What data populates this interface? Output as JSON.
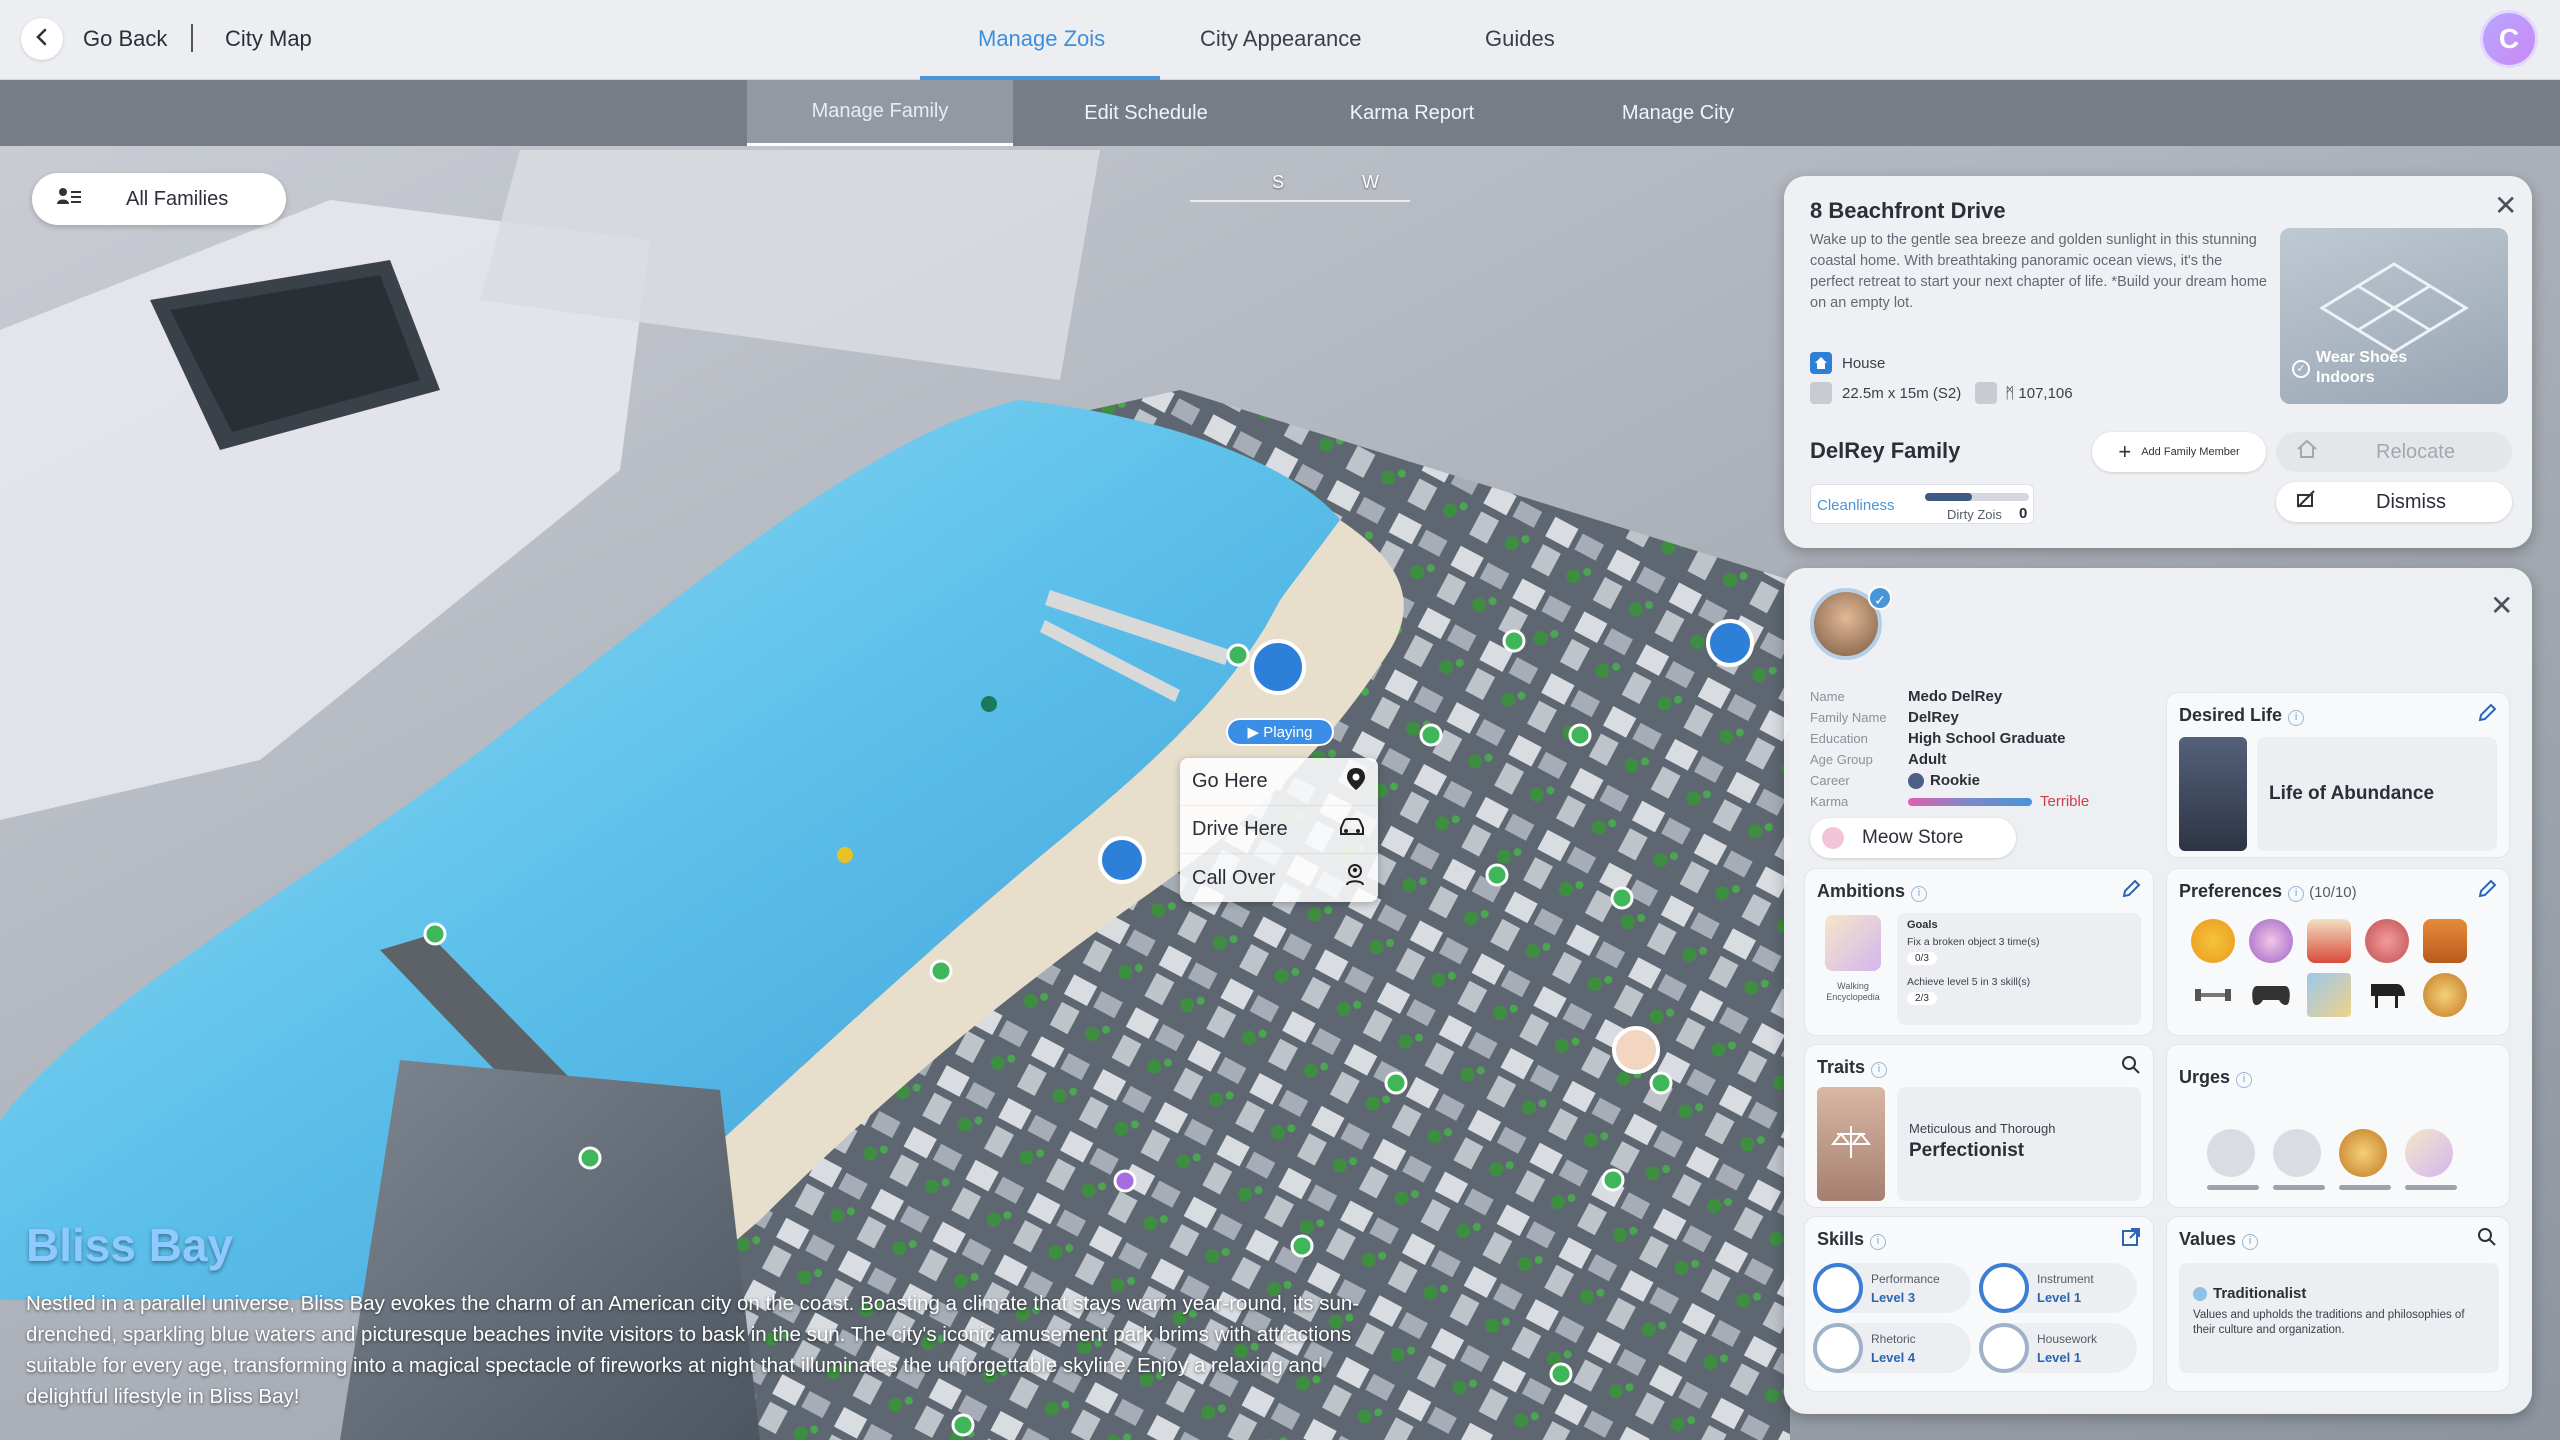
{
  "topbar": {
    "back_label": "Go Back",
    "citymap_label": "City Map",
    "tabs": [
      {
        "label": "Manage Zois",
        "active": true
      },
      {
        "label": "City Appearance",
        "active": false
      },
      {
        "label": "Guides",
        "active": false
      }
    ],
    "profile_initial": "C"
  },
  "subbar": {
    "tabs": [
      {
        "label": "Manage Family",
        "active": true
      },
      {
        "label": "Edit Schedule",
        "active": false
      },
      {
        "label": "Karma Report",
        "active": false
      },
      {
        "label": "Manage City",
        "active": false
      }
    ]
  },
  "map": {
    "families_filter": "All Families",
    "compass": [
      "S",
      "W"
    ],
    "playing_tag": "▶ Playing",
    "context_menu": [
      {
        "label": "Go Here",
        "icon": "location-pin-icon"
      },
      {
        "label": "Drive Here",
        "icon": "car-icon"
      },
      {
        "label": "Call Over",
        "icon": "call-over-icon"
      }
    ],
    "city": {
      "title": "Bliss Bay",
      "description": "Nestled in a parallel universe, Bliss Bay evokes the charm of an American city on the coast. Boasting a climate that stays warm year-round, its sun-drenched, sparkling blue waters and picturesque beaches invite visitors to bask in the sun. The city's iconic amusement park brims with attractions suitable for every age, transforming into a magical spectacle of fireworks at night that illuminates the unforgettable skyline. Enjoy a relaxing and delightful lifestyle in Bliss Bay!"
    },
    "colors": {
      "water": "#6fc6ea",
      "beach": "#e9e0cc",
      "marker": "#3fb65a",
      "home": "#2d7fd8"
    }
  },
  "property": {
    "address": "8 Beachfront Drive",
    "description": "Wake up to the gentle sea breeze and golden sunlight in this stunning coastal home. With breathtaking panoramic ocean views, it's the perfect retreat to start your next chapter of life. *Build your dream home on an empty lot.",
    "type": "House",
    "size": "22.5m x 15m (S2)",
    "price": "ᛗ 107,106",
    "thumbnail_tag": "Wear Shoes Indoors",
    "family_name": "DelRey Family",
    "add_member_label": "Add Family Member",
    "relocate_label": "Relocate",
    "dismiss_label": "Dismiss",
    "cleanliness_label": "Cleanliness",
    "cleanliness_level": 0.45,
    "dirty_zois_label": "Dirty Zois",
    "dirty_zois_value": "0"
  },
  "zoi": {
    "info": [
      {
        "label": "Name",
        "value": "Medo DelRey"
      },
      {
        "label": "Family Name",
        "value": "DelRey"
      },
      {
        "label": "Education",
        "value": "High School Graduate"
      },
      {
        "label": "Age Group",
        "value": "Adult"
      },
      {
        "label": "Career",
        "value": "Rookie"
      },
      {
        "label": "Karma",
        "value": "Terrible"
      }
    ],
    "store_label": "Meow Store",
    "desired_life": {
      "title": "Desired Life",
      "value": "Life of Abundance"
    },
    "ambitions": {
      "title": "Ambitions",
      "badge": "Walking Encyclopedia",
      "goals_label": "Goals",
      "goals": [
        {
          "text": "Fix a broken object 3 time(s)",
          "progress": "0/3"
        },
        {
          "text": "Achieve level 5 in 3 skill(s)",
          "progress": "2/3"
        }
      ]
    },
    "preferences": {
      "title": "Preferences",
      "count": "(10/10)",
      "icons": [
        "fruit-icon",
        "fairy-icon",
        "cake-icon",
        "steak-icon",
        "reindeer-icon",
        "dumbbell-icon",
        "gamepad-icon",
        "painting-icon",
        "piano-icon",
        "bowl-icon"
      ]
    },
    "traits": {
      "title": "Traits",
      "subtitle": "Meticulous and Thorough",
      "name": "Perfectionist"
    },
    "urges": {
      "title": "Urges",
      "icons": [
        "dumbbell-icon",
        "gamepad-icon",
        "bowl-icon",
        "easel-icon"
      ]
    },
    "skills": {
      "title": "Skills",
      "items": [
        {
          "name": "Performance",
          "level": "Level 3"
        },
        {
          "name": "Instrument",
          "level": "Level 1"
        },
        {
          "name": "Rhetoric",
          "level": "Level 4"
        },
        {
          "name": "Housework",
          "level": "Level 1"
        }
      ]
    },
    "values": {
      "title": "Values",
      "name": "Traditionalist",
      "description": "Values and upholds the traditions and philosophies of their culture and organization."
    }
  }
}
